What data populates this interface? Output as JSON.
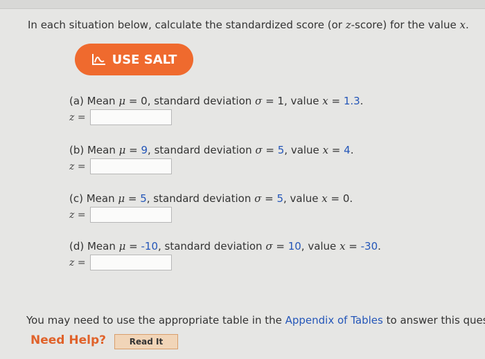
{
  "instructions": {
    "text_before": "In each situation below, calculate the standardized score (or ",
    "z_symbol": "z",
    "text_after": "-score) for the value ",
    "x_symbol": "x",
    "period": "."
  },
  "salt_button": {
    "label": "USE SALT",
    "icon": "salt-chart-icon",
    "color": "#ef6a2e"
  },
  "questions": [
    {
      "prefix": "(a) Mean ",
      "mu_symbol": "μ",
      "eq": " = ",
      "mean": "0",
      "sd_text": ", standard deviation ",
      "sigma_symbol": "σ",
      "sd": "1",
      "value_text": ", value ",
      "x_symbol": "x",
      "value": "1.3",
      "end": ".",
      "z_label": "z =",
      "answer": ""
    },
    {
      "prefix": "(b) Mean ",
      "mu_symbol": "μ",
      "eq": " = ",
      "mean": "9",
      "sd_text": ", standard deviation ",
      "sigma_symbol": "σ",
      "sd": "5",
      "value_text": ", value ",
      "x_symbol": "x",
      "value": "4",
      "end": ".",
      "z_label": "z =",
      "answer": ""
    },
    {
      "prefix": "(c) Mean ",
      "mu_symbol": "μ",
      "eq": " = ",
      "mean": "5",
      "sd_text": ", standard deviation ",
      "sigma_symbol": "σ",
      "sd": "5",
      "value_text": ", value ",
      "x_symbol": "x",
      "value": "0",
      "end": ".",
      "z_label": "z =",
      "answer": ""
    },
    {
      "prefix": "(d) Mean ",
      "mu_symbol": "μ",
      "eq": " = ",
      "mean": "-10",
      "sd_text": ", standard deviation ",
      "sigma_symbol": "σ",
      "sd": "10",
      "value_text": ", value ",
      "x_symbol": "x",
      "value": "-30",
      "end": ".",
      "z_label": "z =",
      "answer": ""
    }
  ],
  "footer": {
    "text_before": "You may need to use the appropriate table in the ",
    "link": "Appendix of Tables",
    "text_after": " to answer this ques"
  },
  "help": {
    "label": "Need Help?",
    "read_it": "Read It"
  },
  "colors": {
    "accent_orange": "#ef6a2e",
    "link_blue": "#2456b8",
    "background": "#e6e6e4"
  }
}
